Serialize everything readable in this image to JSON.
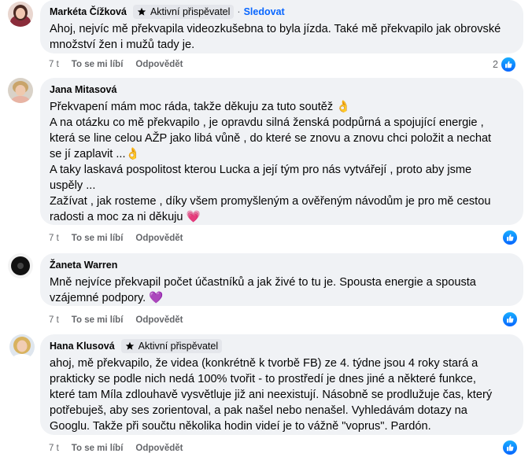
{
  "ui": {
    "like_label": "To se mi líbí",
    "reply_label": "Odpovědět",
    "follow_label": "Sledovat",
    "dot": "·",
    "badge_label": "Aktivní přispěvatel"
  },
  "comments": [
    {
      "author": "Markéta Čížková",
      "time": "7 t",
      "reaction_count": "2",
      "lines": [
        "Ahoj, nejvíc mě překvapila videozkušebna to byla jízda. Také mě překvapilo jak obrovské",
        "množství žen i mužů tady je."
      ]
    },
    {
      "author": "Jana Mitasová",
      "time": "7 t",
      "lines": [
        "Překvapení mám moc ráda, takže děkuju za tuto soutěž 👌",
        "A na otázku co mě překvapilo , je opravdu silná ženská podpůrná a spojující energie ,",
        "která se line celou AŽP jako libá vůně , do které se znovu a znovu chci položit a nechat",
        "se jí zaplavit ...👌",
        "A taky laskavá pospolitost kterou Lucka a její tým pro nás vytvářejí , proto aby jsme",
        "uspěly ...",
        "Zažívat , jak rosteme , díky všem promyšleným a ověřeným návodům je pro mě cestou",
        "radosti a moc za ni děkuju 💗"
      ]
    },
    {
      "author": "Žaneta Warren",
      "time": "7 t",
      "lines": [
        "Mně nejvíce překvapil počet účastníků a jak živé to tu je. Spousta energie a spousta",
        "vzájemné podpory. 💜"
      ]
    },
    {
      "author": "Hana Klusová",
      "time": "7 t",
      "lines": [
        "ahoj, mě překvapilo, že videa (konkrétně k tvorbě FB) ze 4. týdne jsou 4 roky stará a",
        "prakticky se podle nich nedá 100% tvořit - to prostředí je dnes jiné a některé funkce,",
        "které tam Míla zdlouhavě vysvětluje již ani neexistují. Násobně se prodlužuje čas, který",
        "potřebuješ, aby ses zorientoval, a pak našel nebo nenašel. Vyhledávám dotazy na",
        "Googlu. Takže při součtu několika hodin videí je to vážně \"voprus\". Pardón."
      ]
    }
  ]
}
